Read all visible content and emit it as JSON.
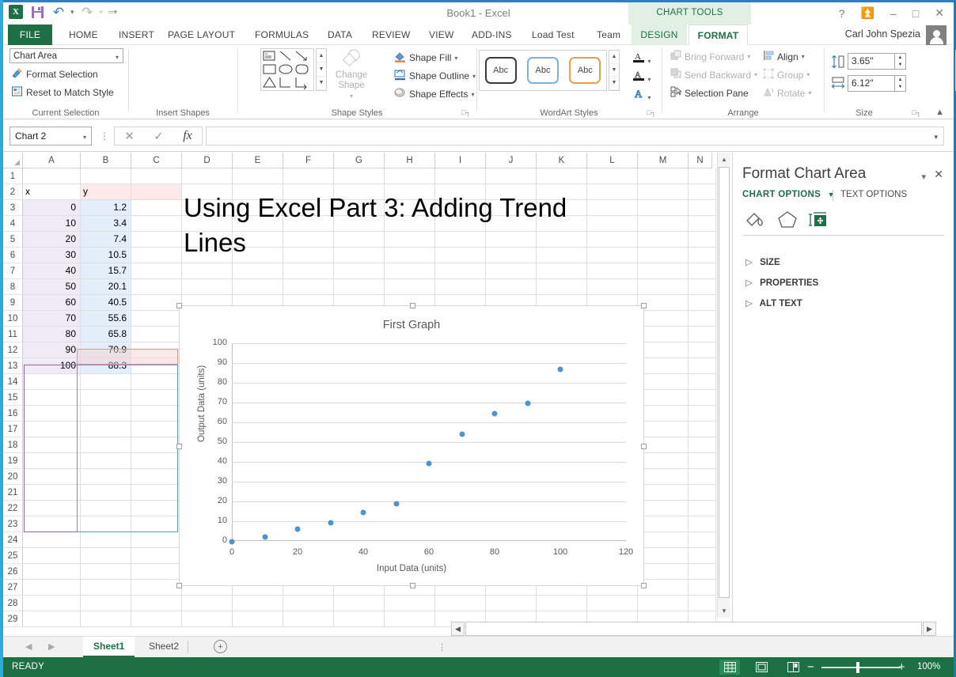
{
  "window": {
    "doc_title": "Book1 - Excel",
    "contextual_tab_group": "CHART TOOLS",
    "user_name": "Carl John Spezia",
    "quick_access": [
      "excel-logo",
      "save-icon",
      "undo-icon",
      "redo-icon",
      "customize-qat-icon"
    ],
    "window_buttons": [
      "help-icon",
      "ribbon-display-options-icon",
      "minimize-icon",
      "restore-icon",
      "close-icon"
    ]
  },
  "ribbon": {
    "tabs": [
      "FILE",
      "HOME",
      "INSERT",
      "PAGE LAYOUT",
      "FORMULAS",
      "DATA",
      "REVIEW",
      "VIEW",
      "ADD-INS",
      "Load Test",
      "Team"
    ],
    "contextual_tabs": [
      "DESIGN",
      "FORMAT"
    ],
    "active_tab": "FORMAT",
    "groups": {
      "current_selection": {
        "label": "Current Selection",
        "selected_element": "Chart Area",
        "items": [
          "Format Selection",
          "Reset to Match Style"
        ]
      },
      "insert_shapes": {
        "label": "Insert Shapes",
        "change_shape": "Change Shape"
      },
      "shape_styles": {
        "label": "Shape Styles",
        "preview_text": "Abc",
        "items": [
          "Shape Fill",
          "Shape Outline",
          "Shape Effects"
        ]
      },
      "wordart_styles": {
        "label": "WordArt Styles",
        "preview_text": "A",
        "items": [
          "text-fill-icon",
          "text-outline-icon",
          "text-effects-icon"
        ]
      },
      "arrange": {
        "label": "Arrange",
        "items": [
          "Bring Forward",
          "Send Backward",
          "Selection Pane",
          "Align",
          "Group",
          "Rotate"
        ]
      },
      "size": {
        "label": "Size",
        "height": "3.65\"",
        "width": "6.12\""
      }
    }
  },
  "formula_bar": {
    "name_box": "Chart 2",
    "formula_value": "",
    "buttons": [
      "cancel-icon",
      "enter-icon",
      "insert-function-icon"
    ]
  },
  "grid": {
    "columns": [
      "A",
      "B",
      "C",
      "D",
      "E",
      "F",
      "G",
      "H",
      "I",
      "J",
      "K",
      "L",
      "M",
      "N"
    ],
    "rows": [
      1,
      2,
      3,
      4,
      5,
      6,
      7,
      8,
      9,
      10,
      11,
      12,
      13,
      14,
      15,
      16,
      17,
      18,
      19,
      20,
      21,
      22,
      23,
      24,
      25,
      26,
      27,
      28,
      29
    ],
    "data": [
      {
        "row": 2,
        "a": "x",
        "b": "y"
      },
      {
        "row": 3,
        "a": "0",
        "b": "1.2"
      },
      {
        "row": 4,
        "a": "10",
        "b": "3.4"
      },
      {
        "row": 5,
        "a": "20",
        "b": "7.4"
      },
      {
        "row": 6,
        "a": "30",
        "b": "10.5"
      },
      {
        "row": 7,
        "a": "40",
        "b": "15.7"
      },
      {
        "row": 8,
        "a": "50",
        "b": "20.1"
      },
      {
        "row": 9,
        "a": "60",
        "b": "40.5"
      },
      {
        "row": 10,
        "a": "70",
        "b": "55.6"
      },
      {
        "row": 11,
        "a": "80",
        "b": "65.8"
      },
      {
        "row": 12,
        "a": "90",
        "b": "70.9"
      },
      {
        "row": 13,
        "a": "100",
        "b": "88.3"
      }
    ],
    "slide_title": "Using Excel Part 3:  Adding Trend Lines"
  },
  "chart_data": {
    "type": "scatter",
    "title": "First Graph",
    "xlabel": "Input Data (units)",
    "ylabel": "Output Data (units)",
    "x": [
      0,
      10,
      20,
      30,
      40,
      50,
      60,
      70,
      80,
      90,
      100
    ],
    "y": [
      1.2,
      3.4,
      7.4,
      10.5,
      15.7,
      20.1,
      40.5,
      55.6,
      65.8,
      70.9,
      88.3
    ],
    "xlim": [
      0,
      120
    ],
    "ylim": [
      0,
      100
    ],
    "xticks": [
      0,
      20,
      40,
      60,
      80,
      100,
      120
    ],
    "yticks": [
      0,
      10,
      20,
      30,
      40,
      50,
      60,
      70,
      80,
      90,
      100
    ],
    "grid": "horizontal",
    "legend": "none",
    "marker_color": "#4d93cf",
    "series_name": "y"
  },
  "task_pane": {
    "title": "Format Chart Area",
    "tabs": [
      "CHART OPTIONS",
      "TEXT OPTIONS"
    ],
    "active_tab": "CHART OPTIONS",
    "icon_tabs": [
      "fill-line-icon",
      "effects-icon",
      "size-properties-icon"
    ],
    "active_icon_tab": "size-properties-icon",
    "sections": [
      "SIZE",
      "PROPERTIES",
      "ALT TEXT"
    ],
    "header_buttons": [
      "pane-options-icon",
      "close-icon"
    ]
  },
  "sheet_tabs": {
    "tabs": [
      "Sheet1",
      "Sheet2"
    ],
    "active": "Sheet1",
    "add_label": "+"
  },
  "status_bar": {
    "status": "READY",
    "view_buttons": [
      "normal-view-icon",
      "page-layout-view-icon",
      "page-break-view-icon"
    ],
    "active_view": "normal-view-icon",
    "zoom_out": "−",
    "zoom_in": "+",
    "zoom_level": "100%"
  },
  "colors": {
    "accent_green": "#1d7044",
    "title_blue": "#2a7fc9",
    "marker_blue": "#4d93cf"
  }
}
